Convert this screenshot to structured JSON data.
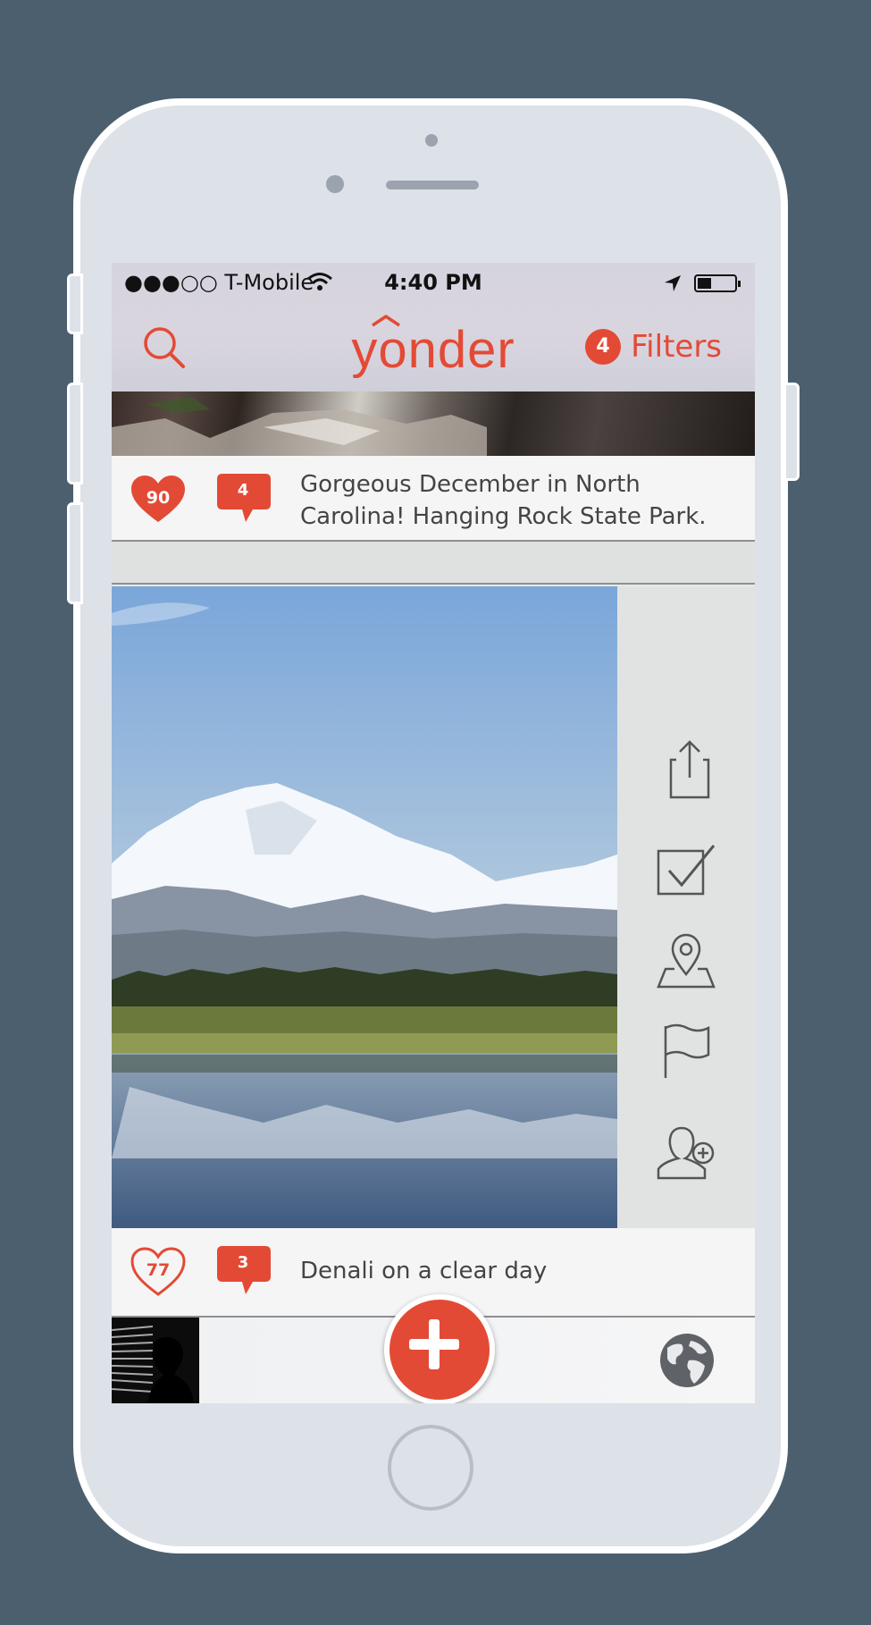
{
  "status_bar": {
    "carrier": "●●●○○ T-Mobile",
    "time": "4:40 PM"
  },
  "nav": {
    "logo": "yonder",
    "filters_count": "4",
    "filters_label": "Filters"
  },
  "posts": [
    {
      "likes": "90",
      "liked": true,
      "comments": "4",
      "caption": "Gorgeous December in North Carolina! Hanging Rock State Park."
    },
    {
      "likes": "77",
      "liked": false,
      "comments": "3",
      "caption": "Denali on a clear day"
    }
  ],
  "actions": [
    "share-icon",
    "checkbox-icon",
    "map-pin-icon",
    "flag-icon",
    "add-user-icon"
  ],
  "colors": {
    "accent": "#e34a35",
    "background": "#4c5f6e",
    "phone_body": "#dde1e8"
  }
}
